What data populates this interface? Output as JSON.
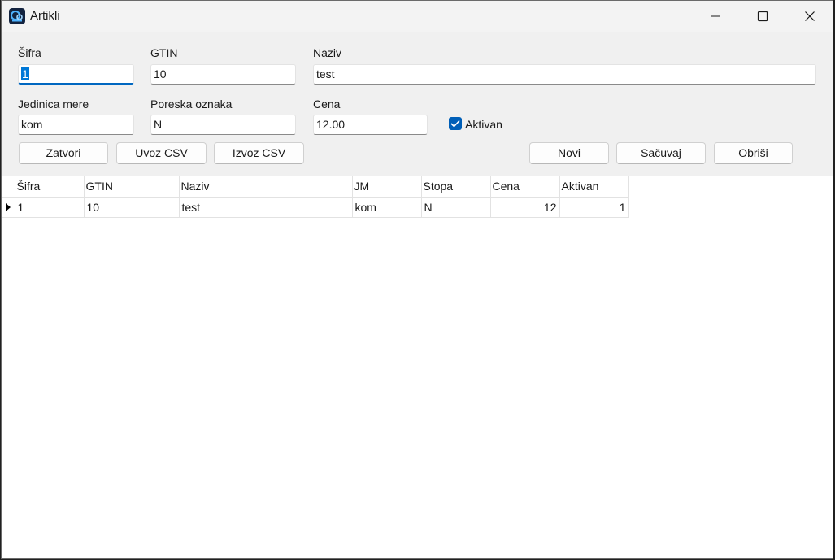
{
  "window": {
    "title": "Artikli",
    "app_icon": "app-logo-icon",
    "controls": [
      "minimize-icon",
      "maximize-icon",
      "close-icon"
    ]
  },
  "form": {
    "sifra": {
      "label": "Šifra",
      "value": "1"
    },
    "gtin": {
      "label": "GTIN",
      "value": "10"
    },
    "naziv": {
      "label": "Naziv",
      "value": "test"
    },
    "jedinica_mere": {
      "label": "Jedinica mere",
      "value": "kom"
    },
    "poreska_oznaka": {
      "label": "Poreska oznaka",
      "value": "N"
    },
    "cena": {
      "label": "Cena",
      "value": "12.00"
    },
    "aktivan": {
      "label": "Aktivan",
      "checked": true
    }
  },
  "buttons": {
    "zatvori": "Zatvori",
    "uvoz_csv": "Uvoz CSV",
    "izvoz_csv": "Izvoz CSV",
    "novi": "Novi",
    "sacuvaj": "Sačuvaj",
    "obrisi": "Obriši"
  },
  "grid": {
    "columns": [
      "Šifra",
      "GTIN",
      "Naziv",
      "JM",
      "Stopa",
      "Cena",
      "Aktivan"
    ],
    "rows": [
      {
        "current": true,
        "cells": [
          "1",
          "10",
          "test",
          "kom",
          "N",
          "12",
          "1"
        ]
      }
    ]
  },
  "colors": {
    "accent": "#0067c0",
    "checkbox": "#005fb8",
    "panel": "#f0f0f0",
    "titlebar": "#f3f3f3"
  }
}
